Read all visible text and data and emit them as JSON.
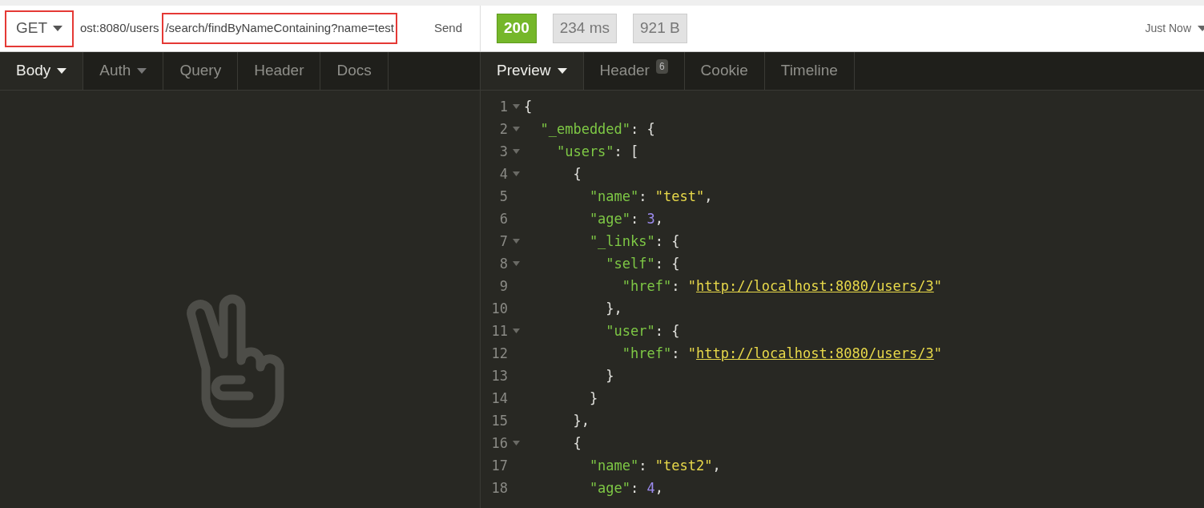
{
  "request": {
    "method": {
      "label": "GET",
      "highlighted": true
    },
    "url_segments": [
      {
        "text": "ost:8080/users",
        "highlighted": false
      },
      {
        "text": "/search/findByNameContaining?name=test",
        "highlighted": true
      }
    ],
    "send_label": "Send"
  },
  "request_tabs": [
    {
      "label": "Body",
      "selected": true,
      "dropdown": true
    },
    {
      "label": "Auth",
      "selected": false,
      "dropdown": true
    },
    {
      "label": "Query",
      "selected": false,
      "dropdown": false
    },
    {
      "label": "Header",
      "selected": false,
      "dropdown": false
    },
    {
      "label": "Docs",
      "selected": false,
      "dropdown": false
    }
  ],
  "response": {
    "status": "200",
    "time": "234 ms",
    "size": "921 B",
    "history": "Just Now"
  },
  "response_tabs": [
    {
      "label": "Preview",
      "selected": true,
      "dropdown": true
    },
    {
      "label": "Header",
      "selected": false,
      "dropdown": false,
      "badge": "6"
    },
    {
      "label": "Cookie",
      "selected": false,
      "dropdown": false
    },
    {
      "label": "Timeline",
      "selected": false,
      "dropdown": false
    }
  ],
  "code_lines": [
    {
      "number": "1",
      "foldable": true,
      "tokens": [
        {
          "kind": "punct",
          "text": "{"
        }
      ],
      "children": [
        {
          "number": "2",
          "foldable": true,
          "tokens": [
            {
              "kind": "key",
              "text": "\"_embedded\""
            },
            {
              "kind": "punct",
              "text": ": {"
            }
          ],
          "children": [
            {
              "number": "3",
              "foldable": true,
              "tokens": [
                {
                  "kind": "key",
                  "text": "\"users\""
                },
                {
                  "kind": "punct",
                  "text": ": ["
                }
              ],
              "children": [
                {
                  "number": "4",
                  "foldable": true,
                  "tokens": [
                    {
                      "kind": "punct",
                      "text": "{"
                    }
                  ],
                  "children": [
                    {
                      "number": "5",
                      "foldable": false,
                      "tokens": [
                        {
                          "kind": "key",
                          "text": "\"name\""
                        },
                        {
                          "kind": "punct",
                          "text": ":"
                        },
                        {
                          "kind": "string",
                          "text": "\"test\""
                        },
                        {
                          "kind": "punct",
                          "text": ","
                        }
                      ]
                    },
                    {
                      "number": "6",
                      "foldable": false,
                      "tokens": [
                        {
                          "kind": "key",
                          "text": "\"age\""
                        },
                        {
                          "kind": "punct",
                          "text": ":"
                        },
                        {
                          "kind": "number",
                          "text": "3"
                        },
                        {
                          "kind": "punct",
                          "text": ","
                        }
                      ]
                    },
                    {
                      "number": "7",
                      "foldable": true,
                      "tokens": [
                        {
                          "kind": "key",
                          "text": "\"_links\""
                        },
                        {
                          "kind": "punct",
                          "text": ": {"
                        }
                      ],
                      "children": [
                        {
                          "number": "8",
                          "foldable": true,
                          "tokens": [
                            {
                              "kind": "key",
                              "text": "\"self\""
                            },
                            {
                              "kind": "punct",
                              "text": ": {"
                            }
                          ],
                          "children": [
                            {
                              "number": "9",
                              "foldable": false,
                              "tokens": [
                                {
                                  "kind": "key",
                                  "text": "\"href\""
                                },
                                {
                                  "kind": "punct",
                                  "text": ":"
                                },
                                {
                                  "kind": "string",
                                  "text": "\""
                                },
                                {
                                  "kind": "link",
                                  "text": "http://localhost:8080/users/3"
                                },
                                {
                                  "kind": "string",
                                  "text": "\""
                                }
                              ]
                            }
                          ]
                        },
                        {
                          "number": "10",
                          "foldable": false,
                          "tokens": [
                            {
                              "kind": "punct",
                              "text": "},"
                            }
                          ]
                        },
                        {
                          "number": "11",
                          "foldable": true,
                          "tokens": [
                            {
                              "kind": "key",
                              "text": "\"user\""
                            },
                            {
                              "kind": "punct",
                              "text": ": {"
                            }
                          ],
                          "children": [
                            {
                              "number": "12",
                              "foldable": false,
                              "tokens": [
                                {
                                  "kind": "key",
                                  "text": "\"href\""
                                },
                                {
                                  "kind": "punct",
                                  "text": ":"
                                },
                                {
                                  "kind": "string",
                                  "text": "\""
                                },
                                {
                                  "kind": "link",
                                  "text": "http://localhost:8080/users/3"
                                },
                                {
                                  "kind": "string",
                                  "text": "\""
                                }
                              ]
                            }
                          ]
                        },
                        {
                          "number": "13",
                          "foldable": false,
                          "tokens": [
                            {
                              "kind": "punct",
                              "text": "}"
                            }
                          ]
                        }
                      ]
                    },
                    {
                      "number": "14",
                      "foldable": false,
                      "tokens": [
                        {
                          "kind": "punct",
                          "text": "}"
                        }
                      ]
                    }
                  ]
                },
                {
                  "number": "15",
                  "foldable": false,
                  "tokens": [
                    {
                      "kind": "punct",
                      "text": "},"
                    }
                  ]
                },
                {
                  "number": "16",
                  "foldable": true,
                  "tokens": [
                    {
                      "kind": "punct",
                      "text": "{"
                    }
                  ],
                  "children": [
                    {
                      "number": "17",
                      "foldable": false,
                      "tokens": [
                        {
                          "kind": "key",
                          "text": "\"name\""
                        },
                        {
                          "kind": "punct",
                          "text": ":"
                        },
                        {
                          "kind": "string",
                          "text": "\"test2\""
                        },
                        {
                          "kind": "punct",
                          "text": ","
                        }
                      ]
                    },
                    {
                      "number": "18",
                      "foldable": false,
                      "tokens": [
                        {
                          "kind": "key",
                          "text": "\"age\""
                        },
                        {
                          "kind": "punct",
                          "text": ":"
                        },
                        {
                          "kind": "number",
                          "text": "4"
                        },
                        {
                          "kind": "punct",
                          "text": ","
                        }
                      ]
                    }
                  ]
                }
              ]
            }
          ]
        }
      ]
    }
  ]
}
